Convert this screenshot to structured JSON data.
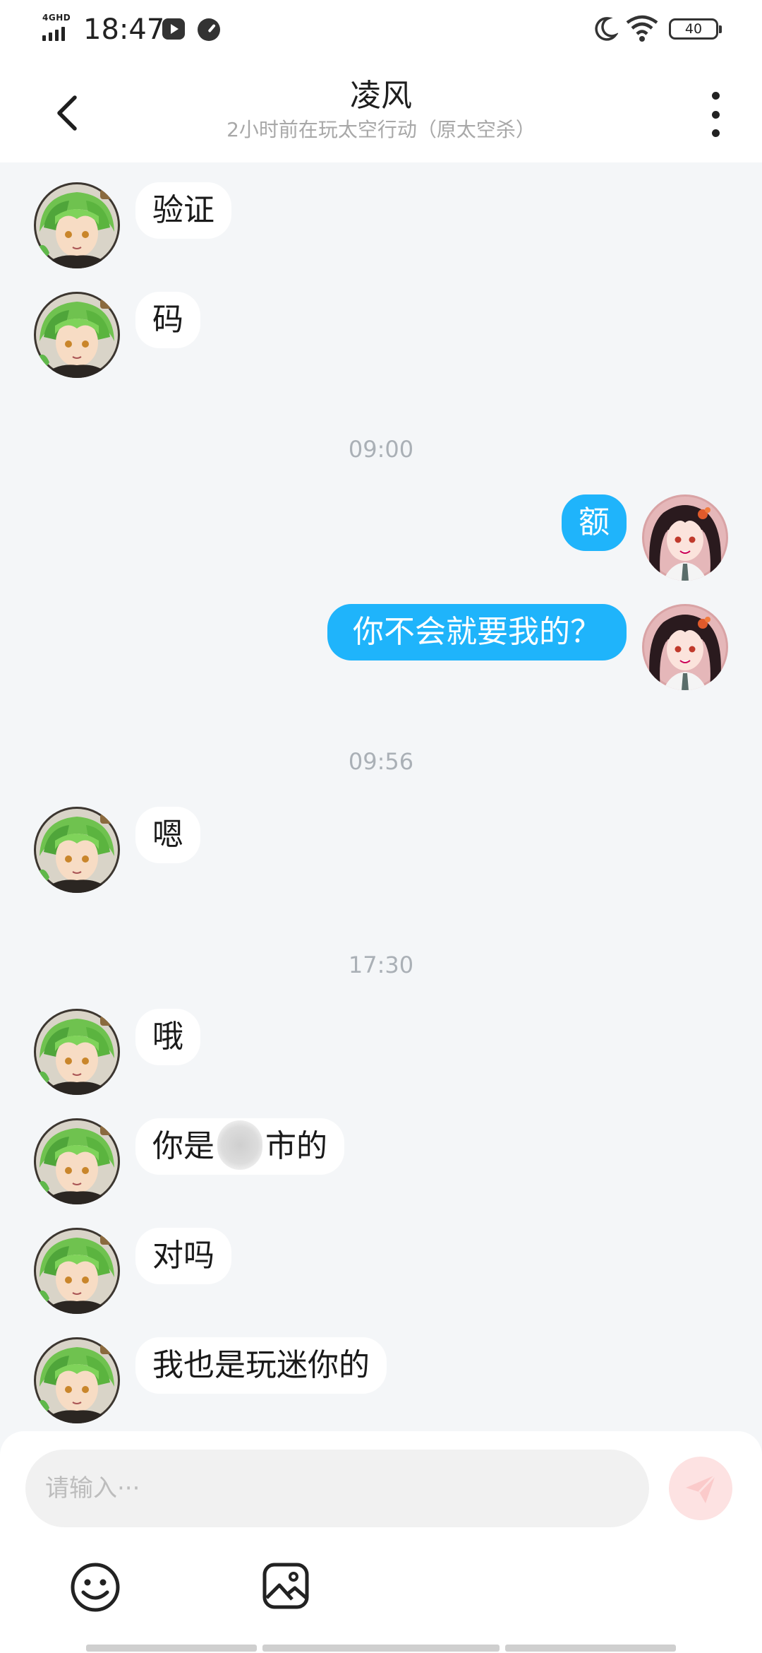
{
  "status_bar": {
    "network_label": "4GHD",
    "time": "18:47",
    "battery": "40",
    "icons": [
      "signal-icon",
      "media-icon",
      "speed-icon",
      "moon-icon",
      "wifi-icon",
      "battery-icon"
    ]
  },
  "header": {
    "title": "凌风",
    "subtitle": "2小时前在玩太空行动（原太空杀）",
    "icons": [
      "back-icon",
      "more-icon"
    ]
  },
  "timestamps": [
    "09:00",
    "09:56",
    "17:30"
  ],
  "messages": [
    {
      "from": "them",
      "text": "验证"
    },
    {
      "from": "them",
      "text": "码"
    },
    {
      "from": "me",
      "text": "额"
    },
    {
      "from": "me",
      "text": "你不会就要我的？"
    },
    {
      "from": "them",
      "text": "嗯"
    },
    {
      "from": "them",
      "text": "哦"
    },
    {
      "from": "them",
      "text_before": "你是",
      "text_after": "市的",
      "redacted": true
    },
    {
      "from": "them",
      "text": "对吗"
    },
    {
      "from": "them",
      "text": "我也是玩迷你的"
    }
  ],
  "composer": {
    "placeholder": "请输入···",
    "icons": [
      "send-icon",
      "emoji-icon",
      "image-icon"
    ]
  },
  "colors": {
    "outgoing_bubble": "#1fb4fb",
    "incoming_bubble": "#ffffff",
    "chat_background": "#f4f6f8",
    "send_button": "#fde2e2"
  }
}
